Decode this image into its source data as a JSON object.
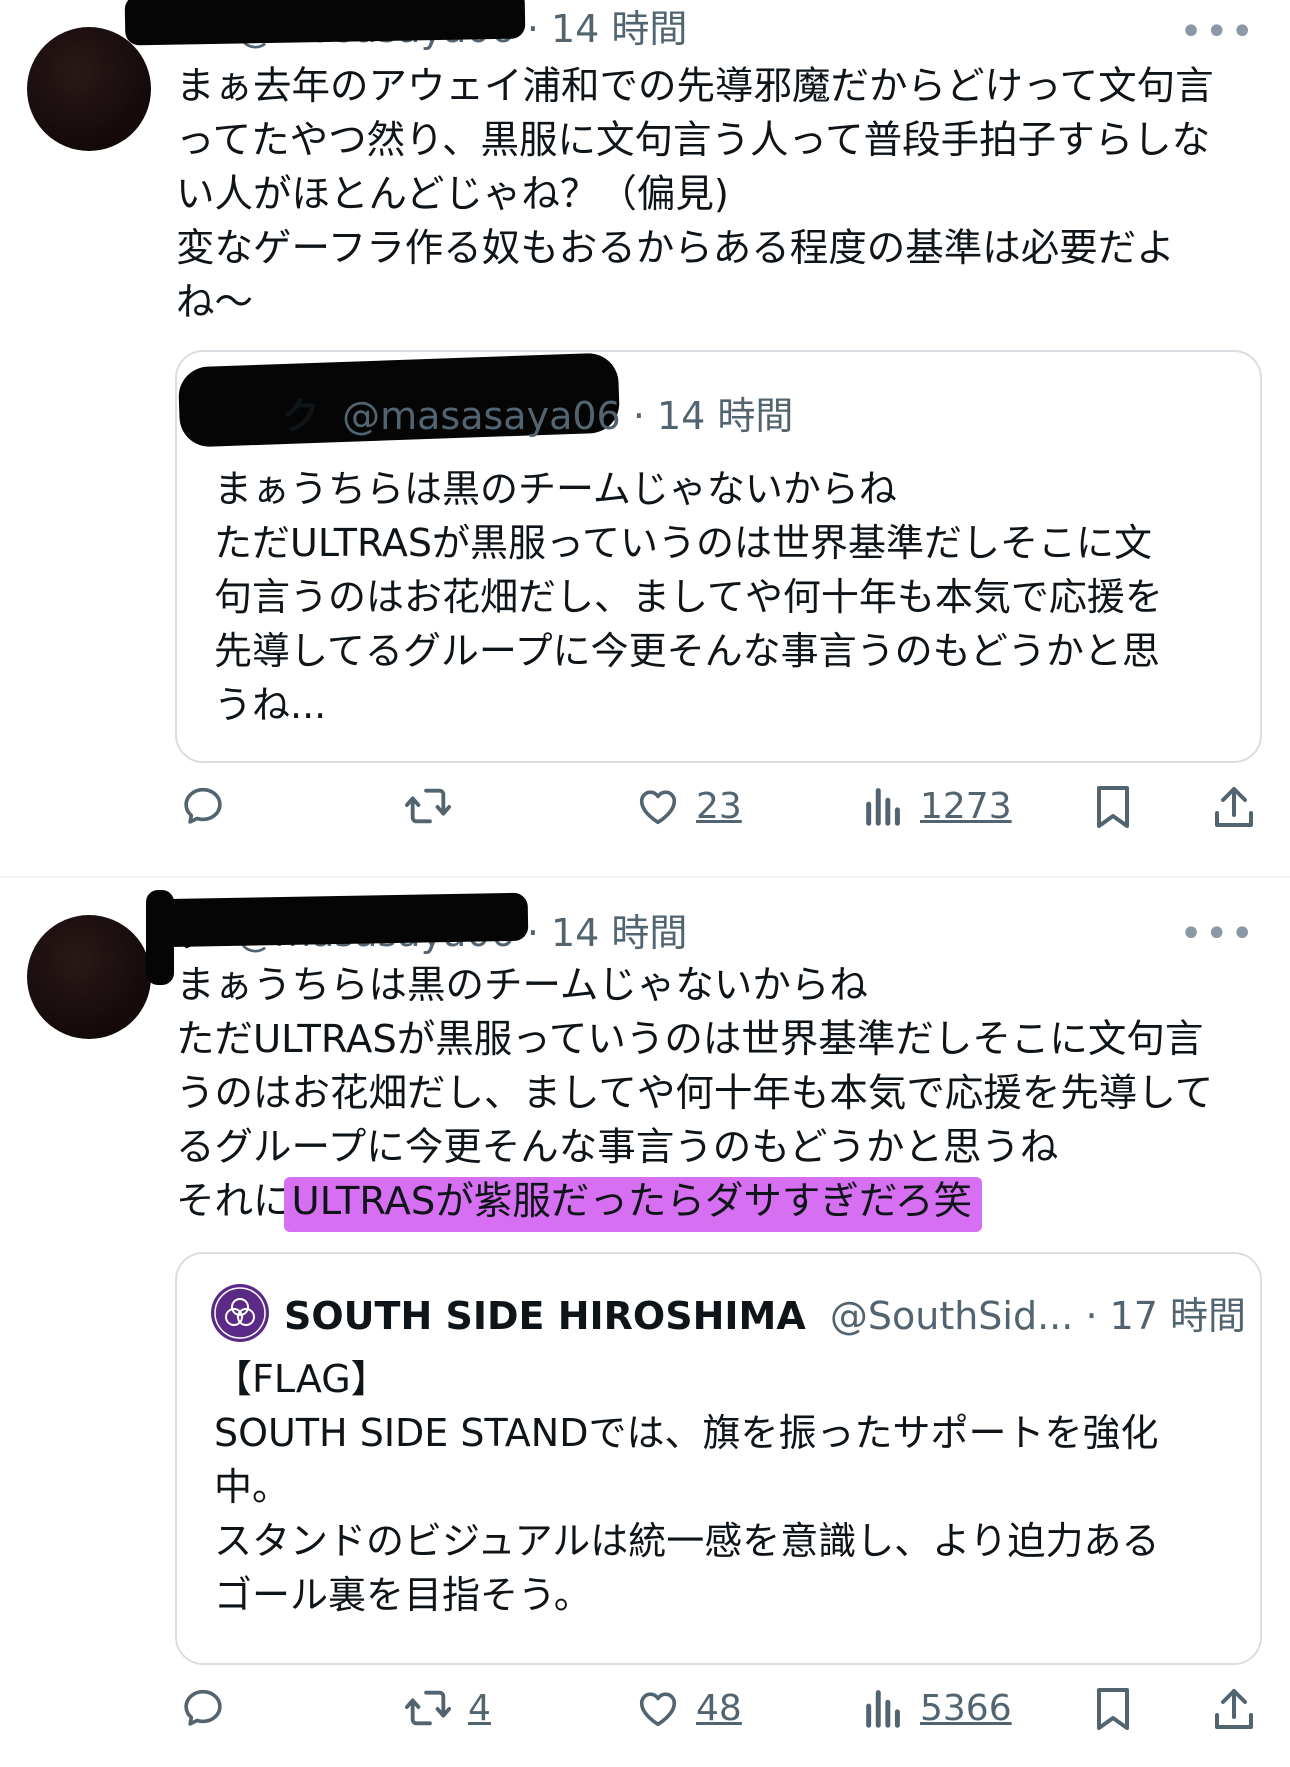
{
  "tweets": [
    {
      "handle": "@masasaya06",
      "name_tail": "ク",
      "time": "· 14 時間",
      "more": "•••",
      "body": [
        "まぁ去年のアウェイ浦和での先導邪魔だからどけって文句言",
        "ってたやつ然り、黒服に文句言う人って普段手拍子すらしな",
        "い人がほとんどじゃね？（偏見)",
        "変なゲーフラ作る奴もおるからある程度の基準は必要だよ",
        "ね〜"
      ],
      "quote": {
        "name_tail": "ク",
        "handle": "@masasaya06",
        "time": "· 14 時間",
        "body": [
          "まぁうちらは黒のチームじゃないからね",
          "ただULTRASが黒服っていうのは世界基準だしそこに文",
          "句言うのはお花畑だし、ましてや何十年も本気で応援を",
          "先導してるグループに今更そんな事言うのもどうかと思",
          "うね..."
        ]
      },
      "actions": {
        "reply": "",
        "retweet": "",
        "like": "23",
        "views": "1273"
      }
    },
    {
      "handle": "@masasaya06",
      "name_tail": "ク",
      "time": "· 14 時間",
      "more": "•••",
      "body": [
        "まぁうちらは黒のチームじゃないからね",
        "ただULTRASが黒服っていうのは世界基準だしそこに文句言",
        "うのはお花畑だし、ましてや何十年も本気で応援を先導して",
        "るグループに今更そんな事言うのもどうかと思うね"
      ],
      "body_last_prefix": "それに",
      "body_last_highlight": "ULTRASが紫服だったらダサすぎだろ笑",
      "highlight_color": "#d66ff2",
      "quote": {
        "name": "SOUTH SIDE HIROSHIMA",
        "handle": "@SouthSid...",
        "time": "· 17 時間",
        "body": [
          "【FLAG】",
          "SOUTH SIDE STANDでは、旗を振ったサポートを強化",
          "中。",
          "スタンドのビジュアルは統一感を意識し、より迫力ある",
          "ゴール裏を目指そう。"
        ]
      },
      "actions": {
        "reply": "",
        "retweet": "4",
        "like": "48",
        "views": "5366"
      }
    }
  ],
  "icons": [
    "reply-icon",
    "retweet-icon",
    "like-icon",
    "views-icon",
    "bookmark-icon",
    "share-icon",
    "more-icon"
  ],
  "colors": {
    "text": "#0f1419",
    "secondary": "#536471",
    "border": "#d9dee2",
    "logo_purple": "#5b2a86"
  }
}
